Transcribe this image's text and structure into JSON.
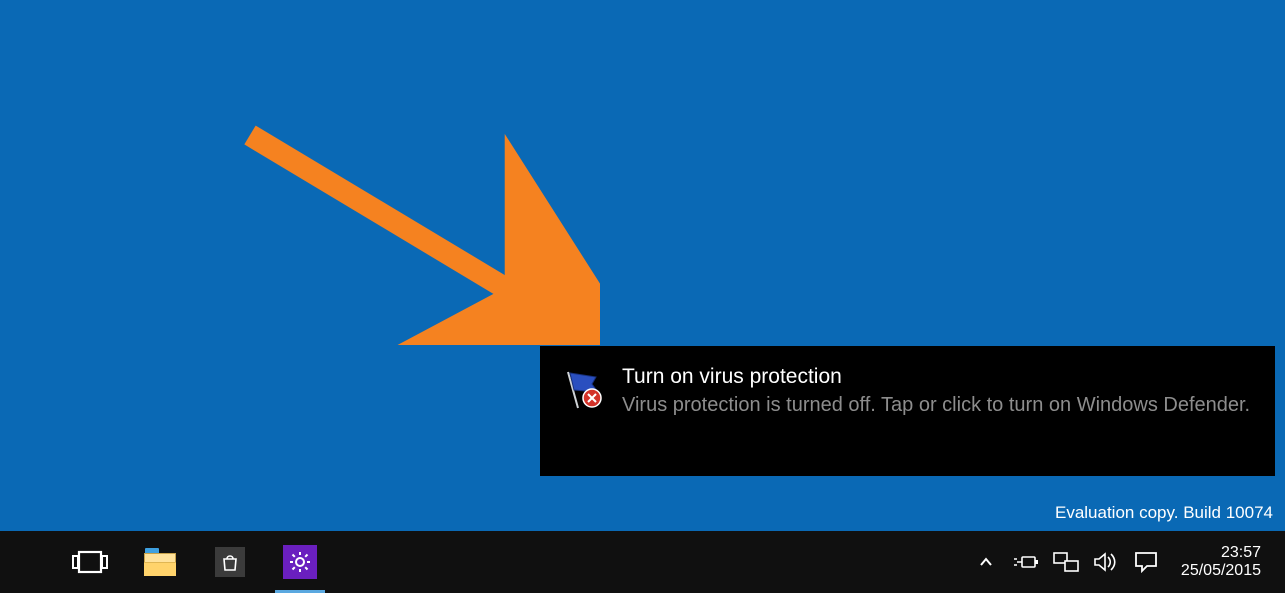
{
  "toast": {
    "title": "Turn on virus protection",
    "body": "Virus protection is turned off. Tap or click to turn on Windows Defender.",
    "icon": "action-center-flag-error"
  },
  "watermark": "Evaluation copy. Build 10074",
  "taskbar": {
    "buttons": {
      "task_view": "task-view",
      "file_explorer": "file-explorer",
      "store": "store",
      "settings": "settings"
    }
  },
  "tray": {
    "show_hidden": "show-hidden-tray",
    "power": "power-icon",
    "network": "network-icon",
    "volume": "volume-icon",
    "action_center": "action-center-icon"
  },
  "clock": {
    "time": "23:57",
    "date": "25/05/2015"
  },
  "annotation": {
    "arrow_color": "#f58220"
  }
}
